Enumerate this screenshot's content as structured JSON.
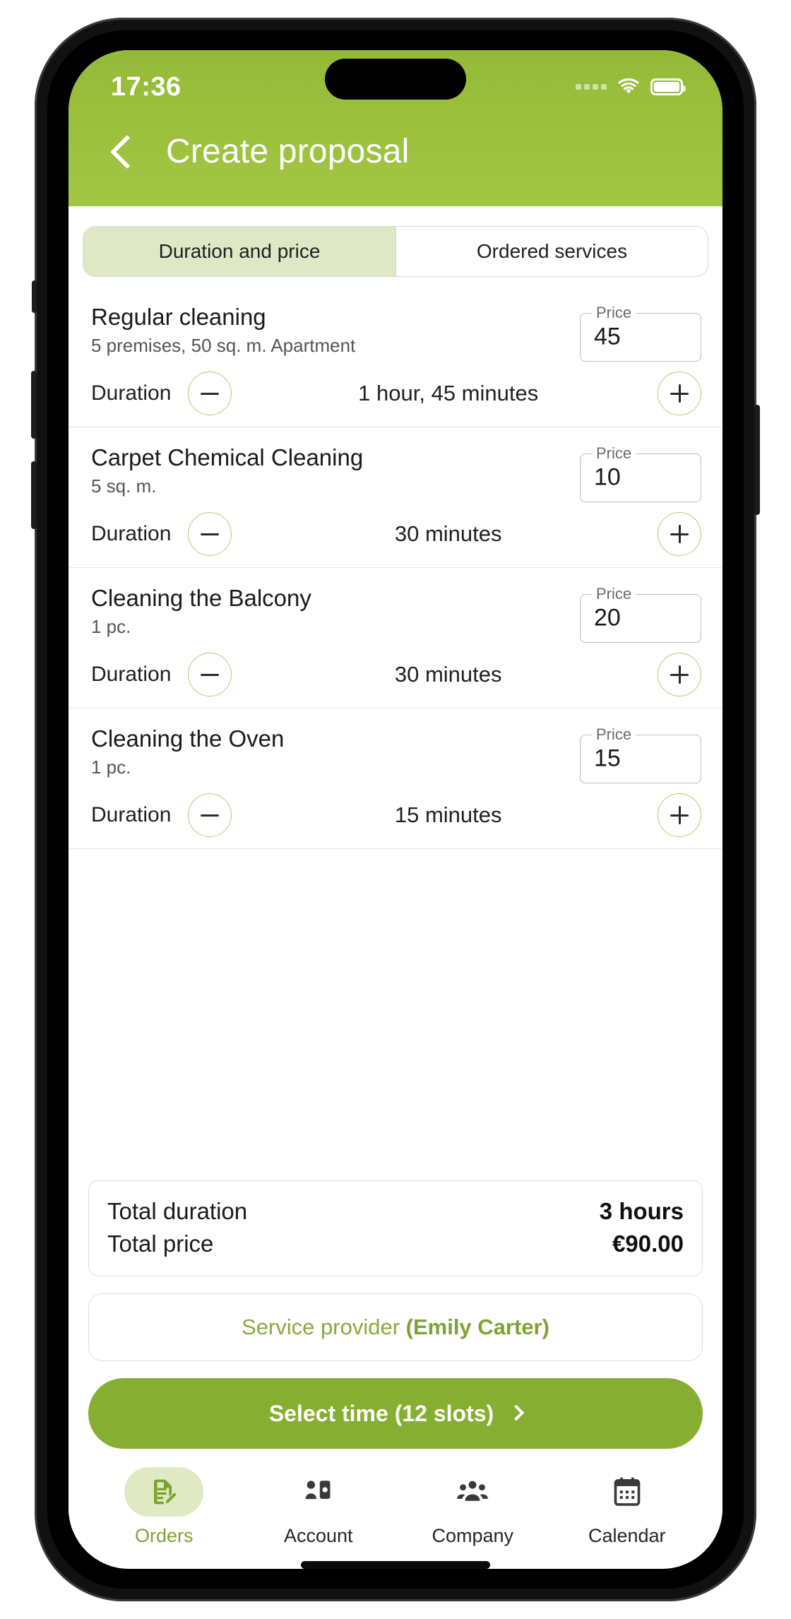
{
  "status_bar": {
    "time": "17:36",
    "wifi_icon": "wifi-icon",
    "battery_icon": "battery-icon",
    "signal_icon": "signal-dots-icon"
  },
  "header": {
    "back_icon": "back-chevron-icon",
    "title": "Create proposal",
    "background_color": "#9cc13f"
  },
  "tabs": {
    "items": [
      {
        "label": "Duration and price",
        "active": true
      },
      {
        "label": "Ordered services",
        "active": false
      }
    ]
  },
  "services": [
    {
      "name": "Regular cleaning",
      "subtitle": "5 premises, 50 sq. m. Apartment",
      "price_label": "Price",
      "price_value": "45",
      "duration_label": "Duration",
      "duration_value": "1 hour, 45 minutes",
      "decrement_icon": "minus-icon",
      "increment_icon": "plus-icon"
    },
    {
      "name": "Carpet Chemical Cleaning",
      "subtitle": "5 sq. m.",
      "price_label": "Price",
      "price_value": "10",
      "duration_label": "Duration",
      "duration_value": "30 minutes",
      "decrement_icon": "minus-icon",
      "increment_icon": "plus-icon"
    },
    {
      "name": "Cleaning the Balcony",
      "subtitle": "1 pc.",
      "price_label": "Price",
      "price_value": "20",
      "duration_label": "Duration",
      "duration_value": "30 minutes",
      "decrement_icon": "minus-icon",
      "increment_icon": "plus-icon"
    },
    {
      "name": "Cleaning the Oven",
      "subtitle": "1 pc.",
      "price_label": "Price",
      "price_value": "15",
      "duration_label": "Duration",
      "duration_value": "15 minutes",
      "decrement_icon": "minus-icon",
      "increment_icon": "plus-icon"
    }
  ],
  "totals": {
    "duration_label": "Total duration",
    "duration_value": "3 hours",
    "price_label": "Total price",
    "price_value": "€90.00"
  },
  "provider": {
    "prefix": "Service provider ",
    "name": "(Emily Carter)",
    "accent_color": "#86ab3b"
  },
  "cta": {
    "label": "Select time (12 slots)",
    "chevron_icon": "chevron-right-icon",
    "background_color": "#86ae30"
  },
  "bottom_nav": {
    "items": [
      {
        "label": "Orders",
        "icon": "document-edit-icon",
        "active": true
      },
      {
        "label": "Account",
        "icon": "person-card-icon",
        "active": false
      },
      {
        "label": "Company",
        "icon": "people-group-icon",
        "active": false
      },
      {
        "label": "Calendar",
        "icon": "calendar-icon",
        "active": false
      }
    ]
  }
}
